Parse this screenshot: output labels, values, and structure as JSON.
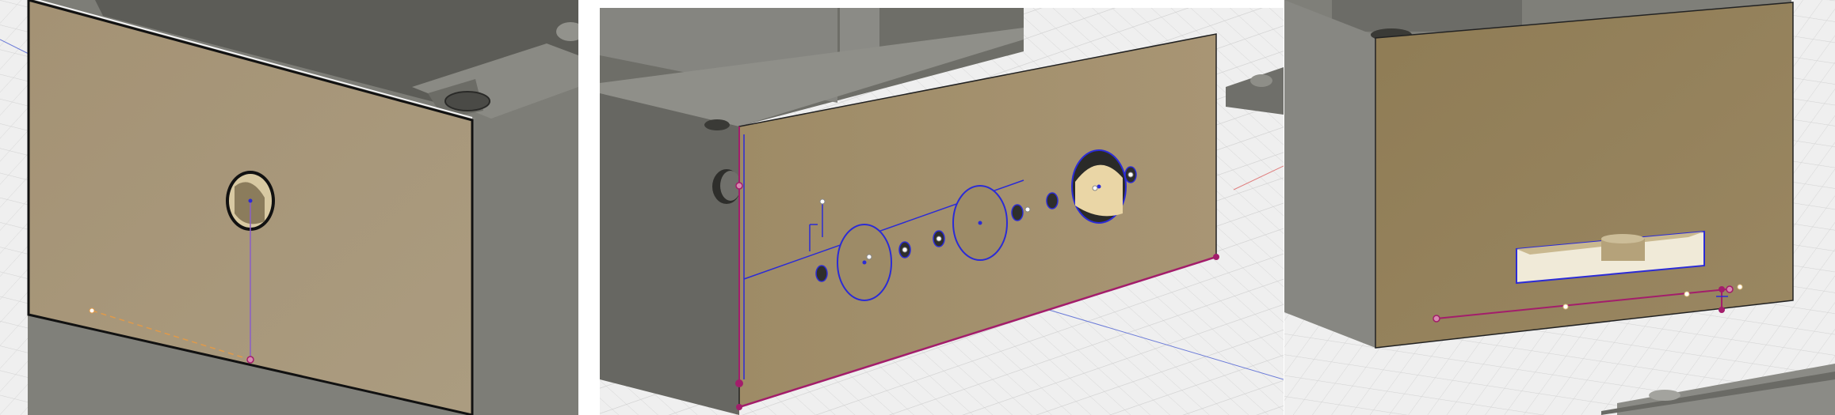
{
  "screenshot": {
    "views": [
      {
        "id": "view-1",
        "subject": "enclosure-side-single-hole"
      },
      {
        "id": "view-2",
        "subject": "enclosure-front-multi-hole"
      },
      {
        "id": "view-3",
        "subject": "enclosure-slot-cutout"
      }
    ],
    "colors": {
      "face_tan": "#a69679",
      "face_tan_dark": "#9b8865",
      "body_gray": "#7c7c76",
      "body_gray_dark": "#5f5f5a",
      "grid_bg": "#eeeeee",
      "sketch_blue": "#2b2bd6",
      "sketch_magenta": "#a31d6b",
      "sketch_orange": "#e09a4a"
    }
  }
}
